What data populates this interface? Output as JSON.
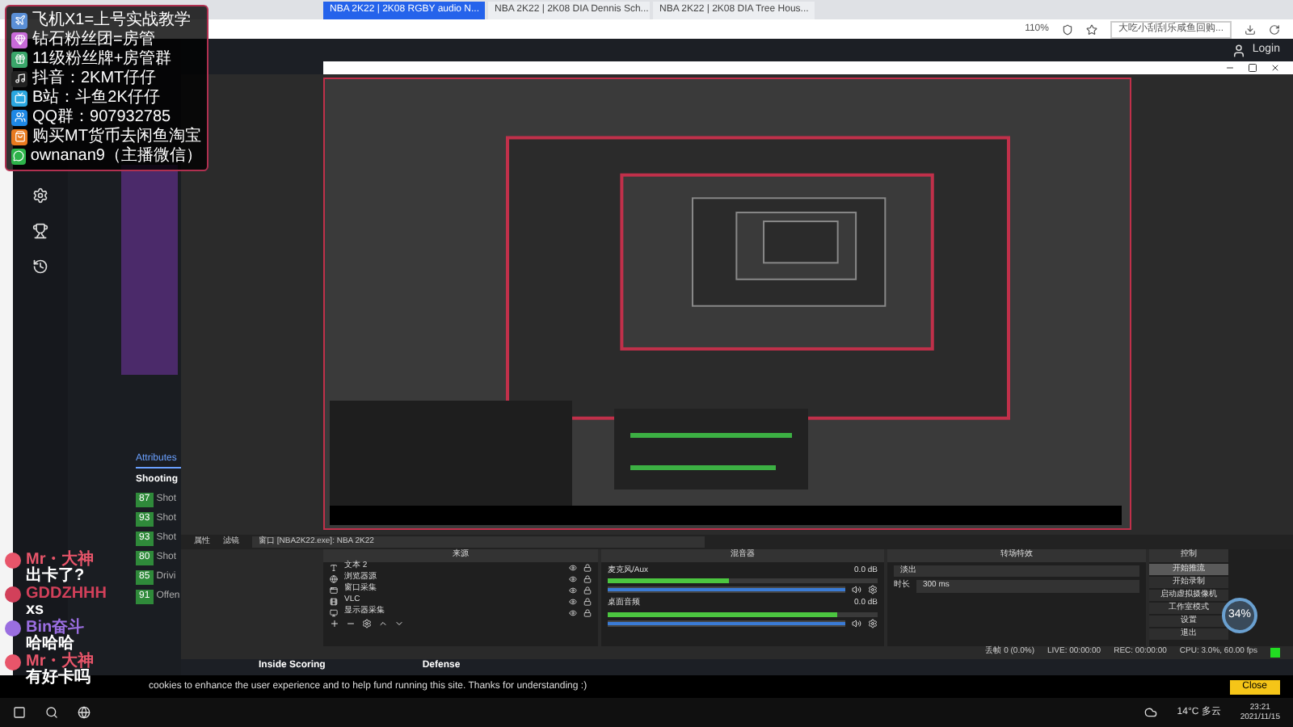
{
  "browser": {
    "tabs": [
      {
        "label": "NBA 2K22 | 2K08 RGBY audio N...",
        "selected": true
      },
      {
        "label": "NBA 2K22 | 2K08 DIA Dennis Sch...",
        "selected": false
      },
      {
        "label": "NBA 2K22 | 2K08 DIA Tree Hous...",
        "selected": false
      }
    ],
    "zoom": "110%",
    "search_hint": "大吃小刮刮乐咸鱼回购..."
  },
  "site": {
    "login": "Login",
    "attributes_tab": "Attributes",
    "section": "Shooting",
    "rows": [
      {
        "value": "87",
        "label": "Shot"
      },
      {
        "value": "93",
        "label": "Shot"
      },
      {
        "value": "93",
        "label": "Shot"
      },
      {
        "value": "80",
        "label": "Shot"
      },
      {
        "value": "85",
        "label": "Drivi"
      },
      {
        "value": "91",
        "label": "Offen"
      }
    ],
    "footer_sections": [
      "Inside Scoring",
      "Defense"
    ]
  },
  "overlay": [
    {
      "kind": "plane",
      "text": "飞机X1=上号实战教学"
    },
    {
      "kind": "gem",
      "text": "钻石粉丝团=房管"
    },
    {
      "kind": "gift",
      "text": "11级粉丝牌+房管群"
    },
    {
      "kind": "tiktok",
      "text": "抖音：2KMT仔仔"
    },
    {
      "kind": "bilibili",
      "text": "B站：斗鱼2K仔仔"
    },
    {
      "kind": "qq",
      "text": "QQ群：907932785"
    },
    {
      "kind": "shop",
      "text": "购买MT货币去闲鱼淘宝"
    },
    {
      "kind": "wechat",
      "text": "ownanan9（主播微信）"
    }
  ],
  "chat": [
    {
      "user": "Mr・大神",
      "color": "#e8556a",
      "message": "出卡了?"
    },
    {
      "user": "GDDZHHH",
      "color": "#d2405a",
      "message": "xs"
    },
    {
      "user": "Bin奋斗",
      "color": "#9a6ee0",
      "message": "哈哈哈"
    },
    {
      "user": "Mr・大神",
      "color": "#e8556a",
      "message": "有好卡吗"
    }
  ],
  "obs": {
    "source_bar": {
      "properties": "属性",
      "filters": "滤镜",
      "window": "窗口 [NBA2K22.exe]: NBA 2K22"
    },
    "sources_title": "来源",
    "sources": [
      {
        "kind": "text",
        "name": "文本 2"
      },
      {
        "kind": "browser",
        "name": "浏览器源"
      },
      {
        "kind": "window",
        "name": "窗口采集"
      },
      {
        "kind": "media",
        "name": "VLC"
      },
      {
        "kind": "display",
        "name": "显示器采集"
      }
    ],
    "mixer_title": "混音器",
    "channels": [
      {
        "name": "麦克风/Aux",
        "reading": "0.0 dB",
        "level": 0.45,
        "volume": {
          "level": 1
        }
      },
      {
        "name": "桌面音频",
        "reading": "0.0 dB",
        "level": 0.85,
        "volume": {
          "level": 1
        }
      }
    ],
    "transitions_title": "转场特效",
    "transition": "淡出",
    "duration_label": "时长",
    "duration": "300 ms",
    "controls_title": "控制",
    "controls": [
      {
        "label": "开始推流",
        "selected": true
      },
      {
        "label": "开始录制",
        "selected": false
      },
      {
        "label": "启动虚拟摄像机",
        "selected": false
      },
      {
        "label": "工作室模式",
        "selected": false
      },
      {
        "label": "设置",
        "selected": false
      },
      {
        "label": "退出",
        "selected": false
      }
    ],
    "status": [
      "丢帧 0 (0.0%)",
      "LIVE: 00:00:00",
      "REC: 00:00:00",
      "CPU: 3.0%, 60.00 fps"
    ],
    "badge": "34%"
  },
  "cookie": {
    "text": "cookies to enhance the user experience and to help fund running this site. Thanks for understanding :)",
    "button": "Close"
  },
  "taskbar": {
    "weather": "14°C 多云",
    "time": "23:21",
    "date": "2021/11/15"
  }
}
